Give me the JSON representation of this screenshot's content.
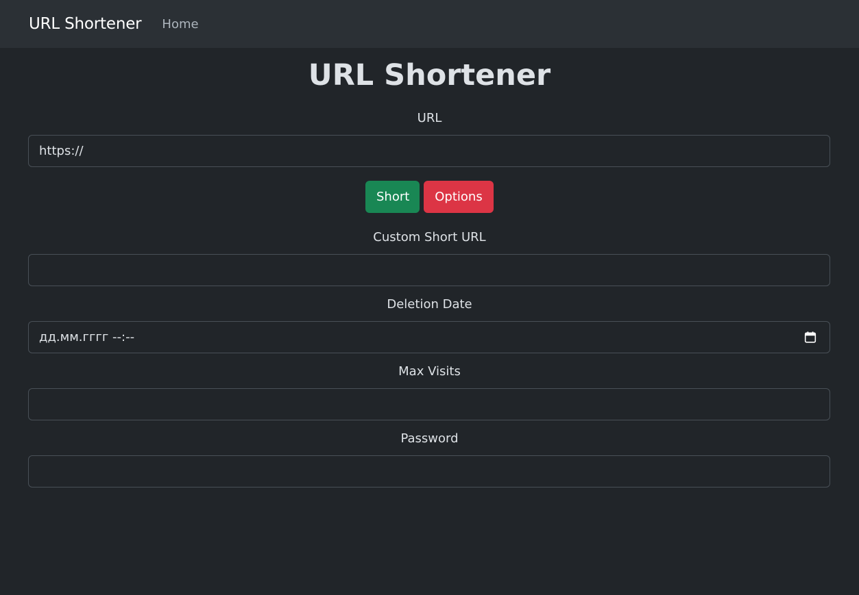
{
  "navbar": {
    "brand": "URL Shortener",
    "home": "Home"
  },
  "main": {
    "title": "URL Shortener",
    "url_label": "URL",
    "url_value": "https://",
    "short_button": "Short",
    "options_button": "Options",
    "custom_label": "Custom Short URL",
    "custom_value": "",
    "deletion_label": "Deletion Date",
    "deletion_value": "дд.мм.гггг --:--",
    "deletion_icon": "calendar-icon",
    "max_visits_label": "Max Visits",
    "max_visits_value": "",
    "password_label": "Password",
    "password_value": ""
  },
  "colors": {
    "background": "#212529",
    "navbar": "#2b3035",
    "success": "#198754",
    "danger": "#dc3545",
    "border": "#495057"
  }
}
